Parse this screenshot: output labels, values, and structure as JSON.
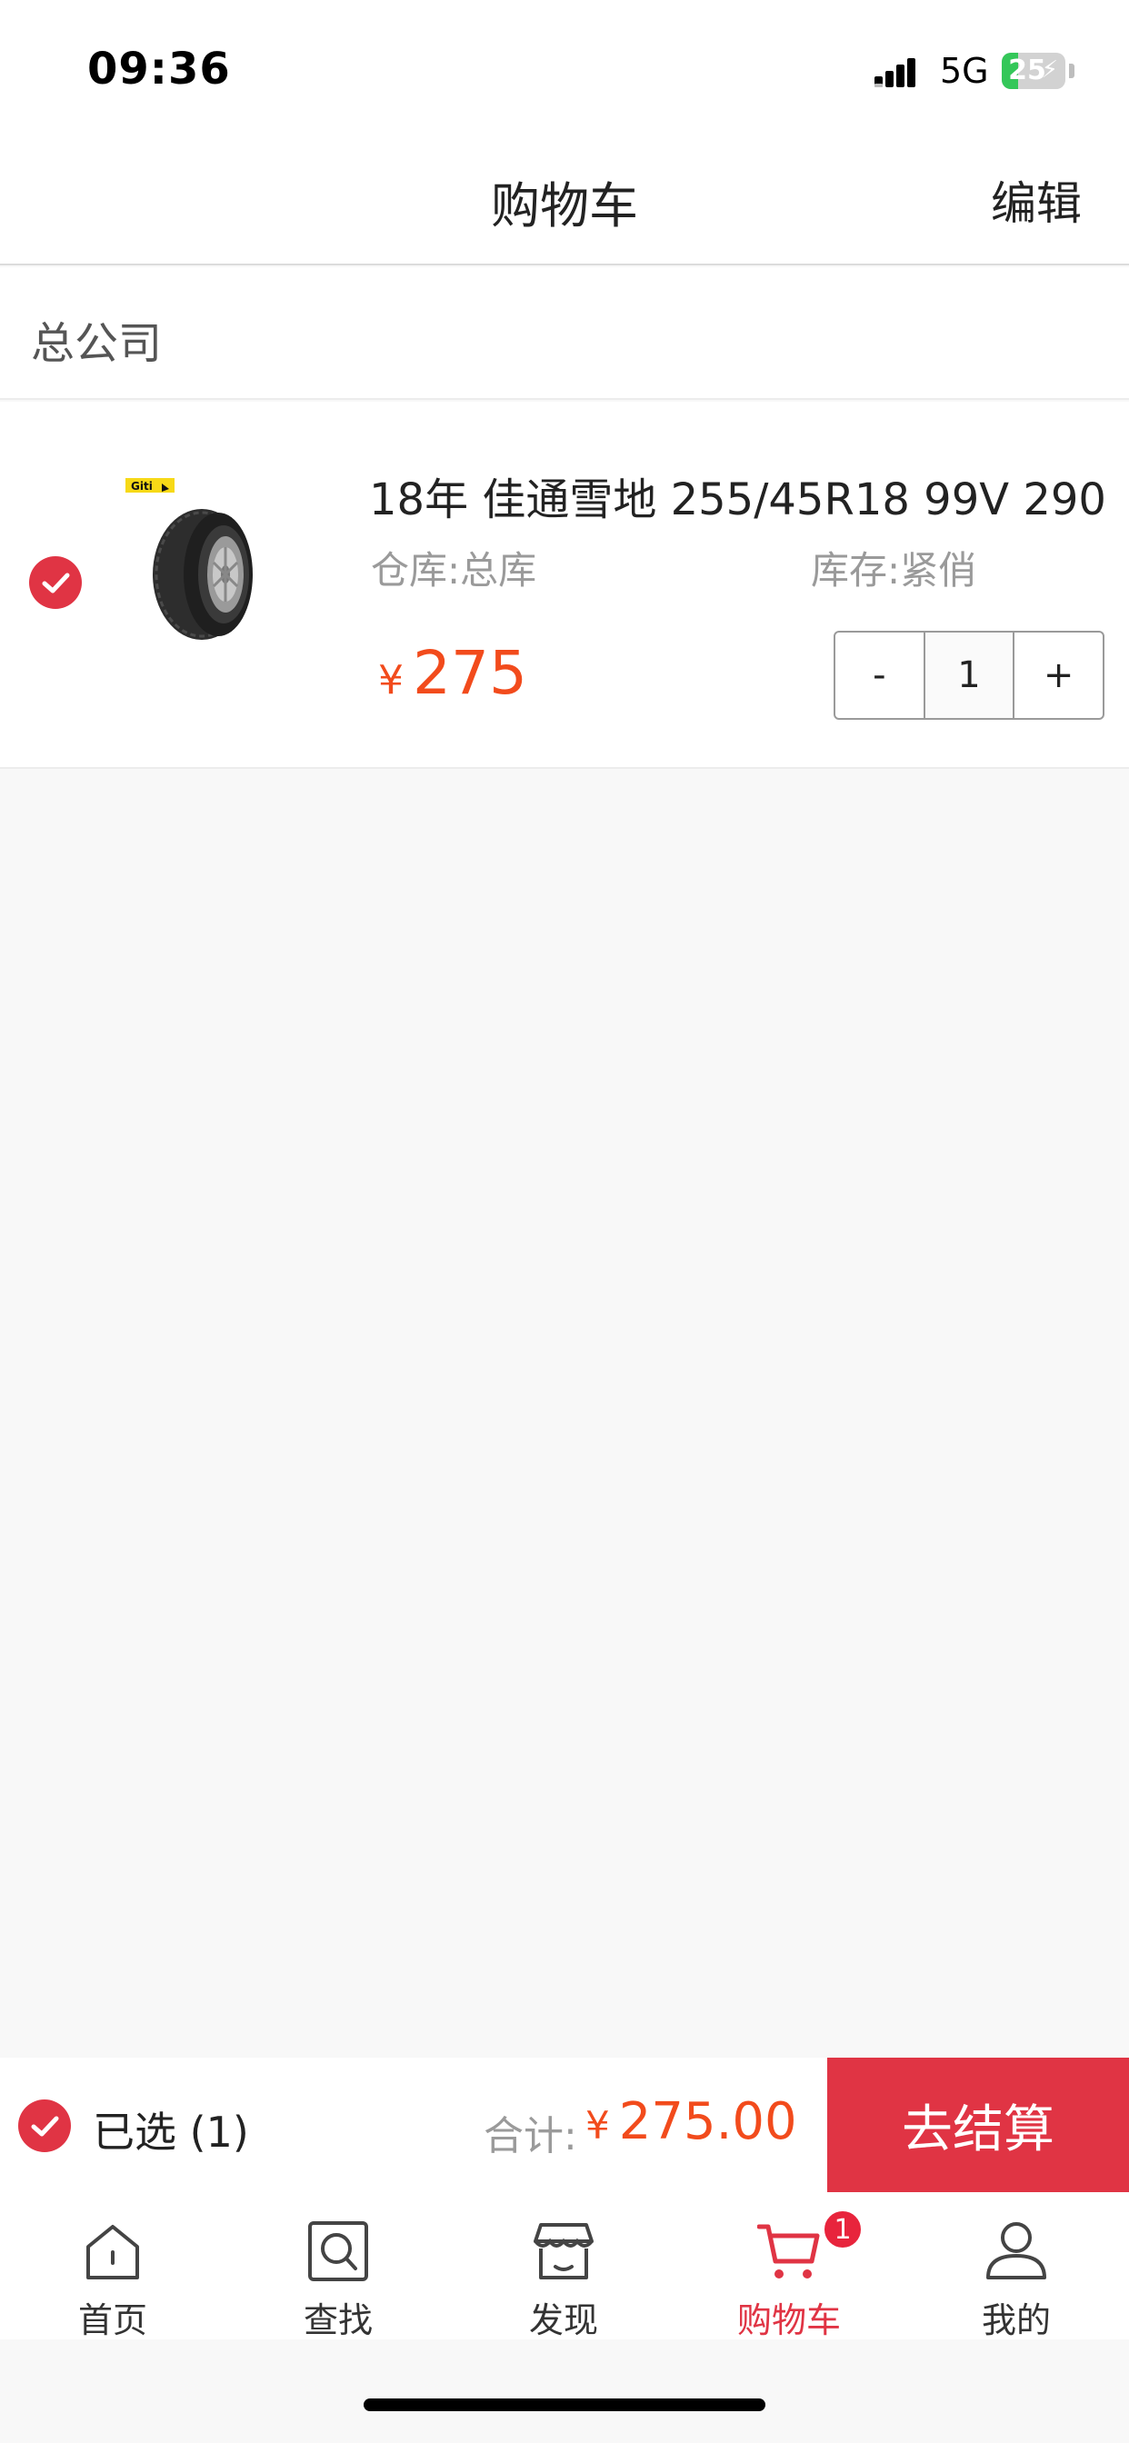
{
  "status_bar": {
    "time": "09:36",
    "network": "5G",
    "battery_level": "25",
    "battery_fraction": 0.25
  },
  "header": {
    "title": "购物车",
    "edit_label": "编辑"
  },
  "store": {
    "name": "总公司"
  },
  "cart_item": {
    "title": "18年 佳通雪地 255/45R18 99V 290",
    "brand_logo_text": "Giti",
    "warehouse": "仓库:总库",
    "stock": "库存:紧俏",
    "currency": "¥",
    "price": "275",
    "quantity": "1",
    "minus_label": "-",
    "plus_label": "+",
    "selected": true
  },
  "checkout": {
    "selected_label": "已选 (1)",
    "total_label": "合计:",
    "currency": "¥",
    "total_amount": "275.00",
    "button_label": "去结算"
  },
  "tabbar": {
    "items": [
      {
        "label": "首页",
        "icon": "home-icon"
      },
      {
        "label": "查找",
        "icon": "search-icon"
      },
      {
        "label": "发现",
        "icon": "store-icon"
      },
      {
        "label": "购物车",
        "icon": "cart-icon",
        "badge": "1",
        "active": true
      },
      {
        "label": "我的",
        "icon": "user-icon"
      }
    ]
  },
  "colors": {
    "accent_red": "#e03444",
    "price_orange": "#f24b1c",
    "battery_green": "#34c759"
  }
}
